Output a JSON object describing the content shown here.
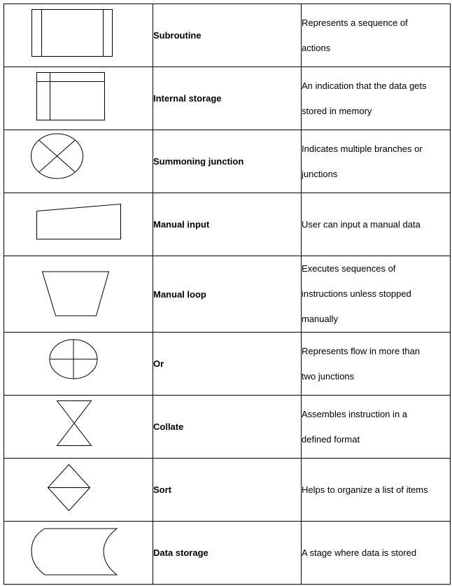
{
  "table": {
    "rows": [
      {
        "symbol": "subroutine-symbol",
        "name": "Subroutine",
        "description": [
          "Represents a sequence of",
          "actions"
        ]
      },
      {
        "symbol": "internal-storage-symbol",
        "name": "Internal storage",
        "description": [
          "An indication that the data gets",
          "stored in memory"
        ]
      },
      {
        "symbol": "summoning-junction-symbol",
        "name": "Summoning junction",
        "description": [
          "Indicates multiple branches or",
          "junctions"
        ]
      },
      {
        "symbol": "manual-input-symbol",
        "name": "Manual input",
        "description": [
          "User can input a manual data"
        ]
      },
      {
        "symbol": "manual-loop-symbol",
        "name": "Manual loop",
        "description": [
          "Executes sequences of",
          "instructions unless stopped",
          "manually"
        ]
      },
      {
        "symbol": "or-symbol",
        "name": "Or",
        "description": [
          "Represents flow in more than",
          "two junctions"
        ]
      },
      {
        "symbol": "collate-symbol",
        "name": "Collate",
        "description": [
          "Assembles instruction in a",
          "defined format"
        ]
      },
      {
        "symbol": "sort-symbol",
        "name": "Sort",
        "description": [
          "Helps to organize a list of items"
        ]
      },
      {
        "symbol": "data-storage-symbol",
        "name": "Data storage",
        "description": [
          "A stage where data is stored"
        ]
      }
    ]
  }
}
